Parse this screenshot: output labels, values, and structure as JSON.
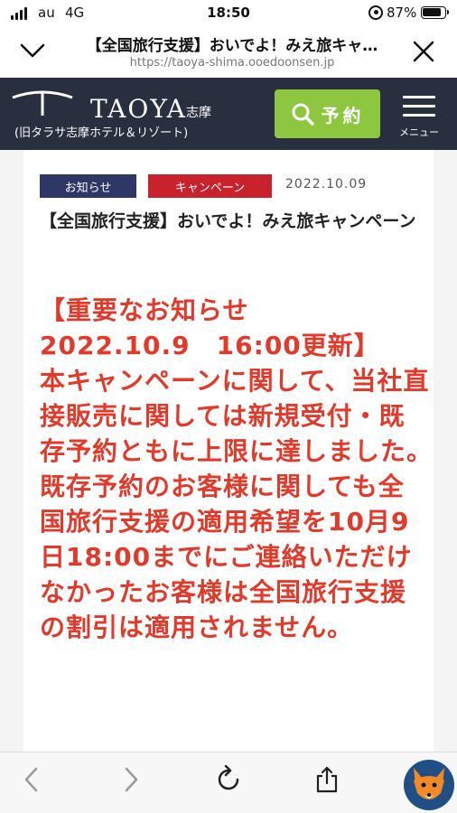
{
  "status_bar": {
    "carrier": "au",
    "network": "4G",
    "time": "18:50",
    "battery": "87%"
  },
  "browser": {
    "page_title": "【全国旅行支援】おいでよ！みえ旅キャ…",
    "url": "https://taoya-shima.ooedoonsen.jp"
  },
  "header": {
    "logo_name": "TAOYA",
    "logo_region": "志摩",
    "logo_sub": "(旧タラサ志摩ホテル＆リゾート)",
    "reserve_label": "予約",
    "menu_label": "メニュー",
    "accent_color": "#8dc63f"
  },
  "article": {
    "tag_news": "お知らせ",
    "tag_campaign": "キャンペーン",
    "date": "2022.10.09",
    "title": "【全国旅行支援】おいでよ！みえ旅キャンペーン",
    "notice_lines": [
      "【重要なお知らせ",
      "2022.10.9　16:00更新】",
      "本キャンペーンに関して、当社直",
      "接販売に関しては新規受付・既",
      "存予約ともに上限に達しました。",
      "既存予約のお客様に関しても全",
      "国旅行支援の適用希望を10月9",
      "日18:00までにご連絡いただけ",
      "なかったお客様は全国旅行支援",
      "の割引は適用されません。"
    ],
    "notice_color": "#e23a2a"
  },
  "toolbar": {
    "back_icon": "chevron-left-icon",
    "forward_icon": "chevron-right-icon",
    "reload_icon": "reload-icon",
    "share_icon": "share-icon"
  }
}
